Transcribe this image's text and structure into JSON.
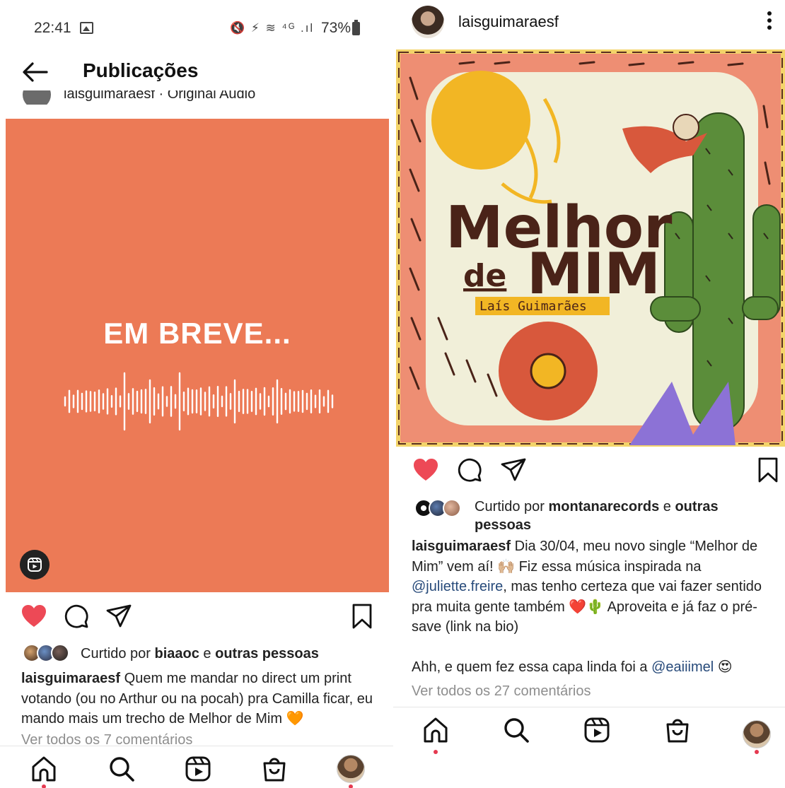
{
  "left": {
    "status_bar": {
      "time": "22:41",
      "battery": "73%",
      "icons": "🔇 ⚡ ≋ ⁴ᴳ .ıl"
    },
    "header": {
      "title": "Publicações"
    },
    "cut_row_text": "laisguimaraesf · Original Audio",
    "reel": {
      "caption": "EM BREVE..."
    },
    "liked_by": {
      "prefix": "Curtido por ",
      "user": "biaaoc",
      "middle": " e ",
      "others": "outras pessoas"
    },
    "caption": {
      "username": "laisguimaraesf",
      "text": " Quem me mandar no direct um print votando (ou no Arthur ou na pocah) pra Camilla ficar, eu mando mais um trecho de Melhor de Mim 🧡"
    },
    "comments_link": "Ver todos os 7 comentários"
  },
  "right": {
    "post_header": {
      "username": "laisguimaraesf"
    },
    "album": {
      "title_line1": "Melhor",
      "title_de": "de",
      "title_mim": "MIM",
      "artist": "Laís Guimarães"
    },
    "liked_by": {
      "prefix": "Curtido por ",
      "user": "montanarecords",
      "middle": " e ",
      "others": "outras pessoas"
    },
    "caption": {
      "username": "laisguimaraesf",
      "part1": " Dia 30/04, meu novo single “Melhor de Mim” vem aí! 🙌🏼 Fiz essa música inspirada na ",
      "mention1": "@juliette.freire",
      "part2": ", mas tenho certeza que vai fazer sentido pra muita gente também ❤️🌵 Aproveita e já faz o pré-save (link na bio)",
      "part3": "Ahh, e quem fez essa capa linda foi a ",
      "mention2": "@eaiiimel",
      "part4": " 😍"
    },
    "comments_link": "Ver todos os 27 comentários"
  },
  "icons": {
    "back": "back-arrow-icon",
    "like": "heart-icon",
    "comment": "comment-icon",
    "share": "send-icon",
    "save": "bookmark-icon",
    "home": "home-icon",
    "search": "search-icon",
    "reels": "reels-icon",
    "shop": "shop-icon",
    "profile": "profile-avatar",
    "more": "more-icon"
  },
  "colors": {
    "like_red": "#ed4956",
    "reel_bg": "#ec7a56",
    "mention": "#274a7a",
    "muted": "#8e8e8e"
  }
}
